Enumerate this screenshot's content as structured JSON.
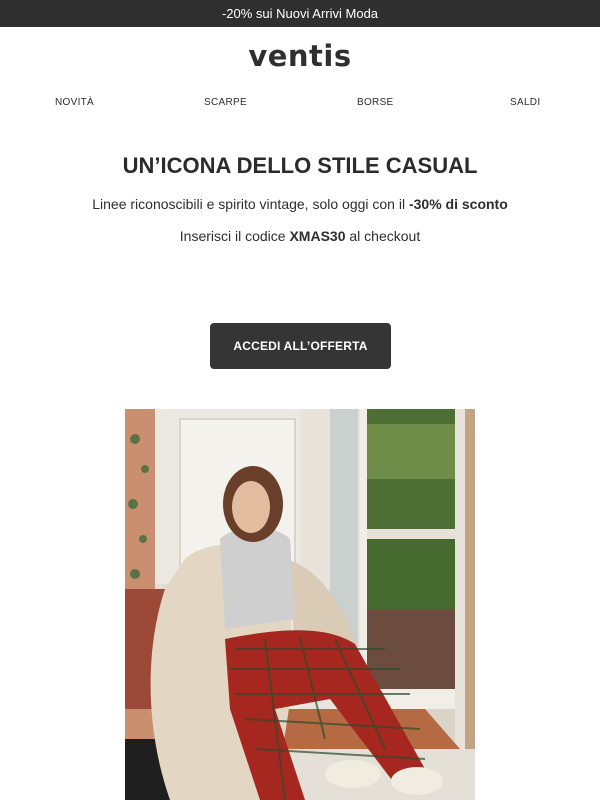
{
  "announcement": "-20% sui Nuovi Arrivi Moda",
  "brand": "ventis",
  "nav": [
    "NOVITÀ",
    "SCARPE",
    "BORSE",
    "SALDI"
  ],
  "hero": {
    "headline": "UN’ICONA DELLO STILE CASUAL",
    "line1_pre": "Linee riconoscibili e spirito vintage, solo oggi con il ",
    "line1_bold": "-30% di sconto",
    "line2_pre": "Inserisci il codice ",
    "line2_code": "XMAS30",
    "line2_post": " al checkout",
    "cta_label": "ACCEDI ALL’OFFERTA"
  },
  "colors": {
    "topbar_bg": "#2f2f2f",
    "cta_bg": "#353535",
    "text": "#2e2e2e"
  }
}
